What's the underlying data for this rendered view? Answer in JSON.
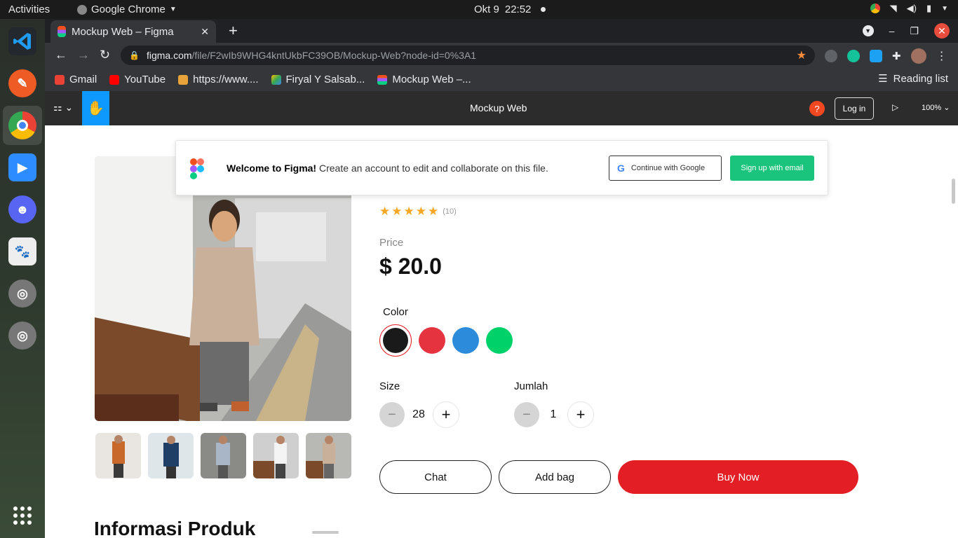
{
  "topbar": {
    "activities": "Activities",
    "app": "Google Chrome",
    "date": "Okt 9",
    "time": "22:52"
  },
  "chrome": {
    "tab_title": "Mockup Web – Figma",
    "url_host": "figma.com",
    "url_path": "/file/F2wIb9WHG4kntUkbFC39OB/Mockup-Web?node-id=0%3A1",
    "bookmarks": [
      {
        "label": "Gmail",
        "icon": "gmail-icon",
        "color": "#ea4335"
      },
      {
        "label": "YouTube",
        "icon": "youtube-icon",
        "color": "#ff0000"
      },
      {
        "label": "https://www....",
        "icon": "package-icon",
        "color": "#e8a33a"
      },
      {
        "label": "Firyal Y Salsab...",
        "icon": "drive-icon",
        "color": "#34a853"
      },
      {
        "label": "Mockup Web –...",
        "icon": "figma-icon",
        "color": "#f24e1e"
      }
    ],
    "reading_list": "Reading list"
  },
  "figma": {
    "file_title": "Mockup Web",
    "help": "?",
    "login": "Log in",
    "zoom": "100%"
  },
  "banner": {
    "title": "Welcome to Figma!",
    "message": " Create an account to edit and collaborate on this file.",
    "google_btn": "Continue with Google",
    "email_btn": "Sign up with email"
  },
  "product": {
    "rating_count": "(10)",
    "price_label": "Price",
    "price": "$ 20.0",
    "color_label": "Color",
    "colors": [
      "#1a1a1a",
      "#e5333f",
      "#2d8bdb",
      "#00d26a"
    ],
    "size_label": "Size",
    "size_value": "28",
    "jumlah_label": "Jumlah",
    "jumlah_value": "1",
    "chat": "Chat",
    "add_bag": "Add bag",
    "buy_now": "Buy Now",
    "info_title": "Informasi Produk"
  }
}
